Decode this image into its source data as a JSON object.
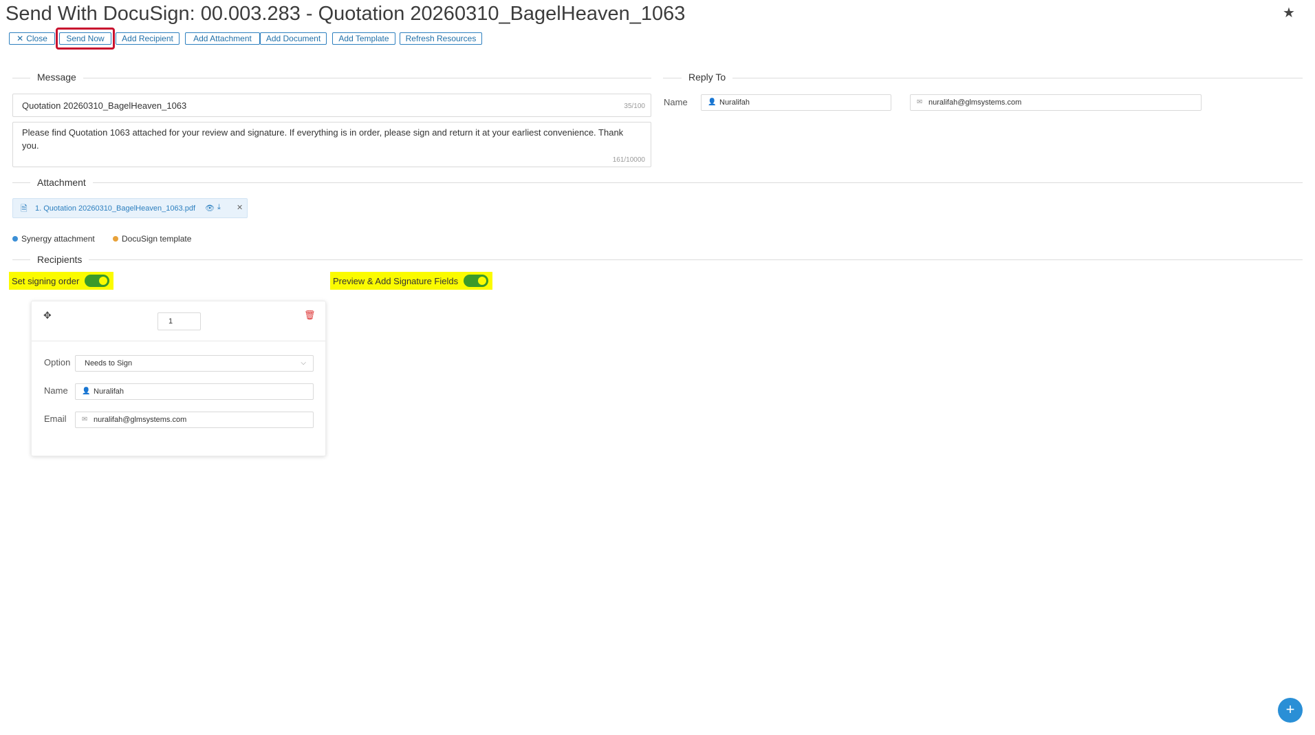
{
  "header": {
    "title": "Send With DocuSign: 00.003.283 - Quotation 20260310_BagelHeaven_1063",
    "star_icon": "star-icon"
  },
  "toolbar": {
    "close_label": "Close",
    "send_now_label": "Send Now",
    "add_recipient_label": "Add Recipient",
    "add_attachment_label": "Add Attachment",
    "add_document_label": "Add Document",
    "add_template_label": "Add Template",
    "refresh_resources_label": "Refresh Resources"
  },
  "message": {
    "section_label": "Message",
    "subject": "Quotation 20260310_BagelHeaven_1063",
    "subject_counter": "35/100",
    "body": "Please find Quotation 1063 attached for your review and signature. If everything is in order, please sign and return it at your earliest convenience. Thank you.",
    "body_counter": "161/10000"
  },
  "reply_to": {
    "section_label": "Reply To",
    "name_label": "Name",
    "name_value": "Nuralifah",
    "email_value": "nuralifah@glmsystems.com"
  },
  "attachment": {
    "section_label": "Attachment",
    "file_label": "1. Quotation 20260310_BagelHeaven_1063.pdf"
  },
  "legend": {
    "synergy_label": "Synergy attachment",
    "synergy_color": "#3b8fd6",
    "docusign_label": "DocuSign template",
    "docusign_color": "#e8a23a"
  },
  "recipients": {
    "section_label": "Recipients",
    "signing_order_label": "Set signing order",
    "signing_order_on": true,
    "preview_label": "Preview & Add Signature Fields",
    "preview_on": true,
    "card": {
      "order_value": "1",
      "option_label": "Option",
      "option_value": "Needs to Sign",
      "name_label": "Name",
      "name_value": "Nuralifah",
      "email_label": "Email",
      "email_value": "nuralifah@glmsystems.com"
    }
  },
  "colors": {
    "accent": "#2c7fbf",
    "highlight": "#fbfb00",
    "toggle_on": "#3a9a2a",
    "send_outline": "#c8102e",
    "fab": "#2a8fd6"
  }
}
